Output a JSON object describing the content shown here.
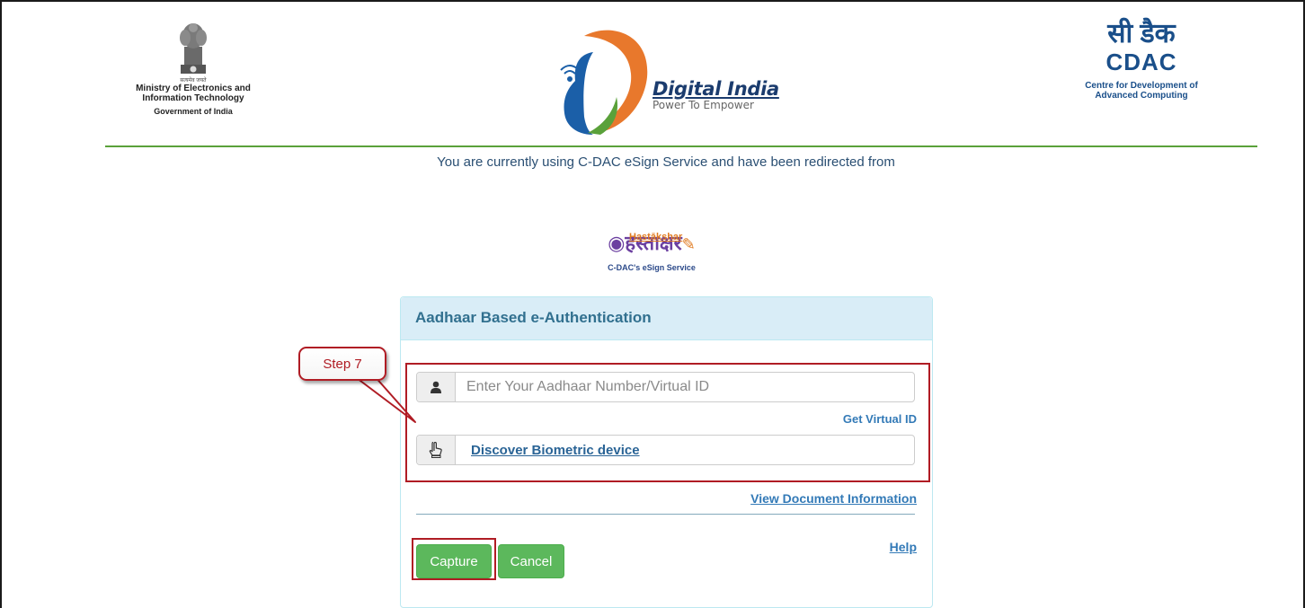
{
  "header": {
    "meity": {
      "motto": "सत्यमेव जयते",
      "line1": "Ministry of Electronics and",
      "line2": "Information Technology",
      "line3": "Government of India"
    },
    "digital_india": {
      "title": "Digital India",
      "subtitle": "Power To Empower"
    },
    "cdac": {
      "hindi": "सी डैक",
      "english": "CDAC",
      "full_line1": "Centre for Development of",
      "full_line2": "Advanced Computing"
    }
  },
  "redirect_notice": "You are currently using C-DAC eSign Service and have been redirected from",
  "esign_logo": {
    "tag": "Hastākshar",
    "brand": "हस्ताक्षर",
    "caption": "C-DAC's eSign Service"
  },
  "panel": {
    "title": "Aadhaar Based e-Authentication",
    "aadhaar_input": {
      "placeholder": "Enter Your Aadhaar Number/Virtual ID",
      "value": ""
    },
    "get_virtual_id": "Get Virtual ID",
    "discover_biometric": "Discover Biometric device",
    "view_document_info": "View Document Information",
    "help": "Help",
    "capture_button": "Capture",
    "cancel_button": "Cancel"
  },
  "annotation": {
    "step_label": "Step 7",
    "color": "#b01c24"
  },
  "colors": {
    "panel_header_bg": "#d9edf7",
    "panel_header_text": "#31708f",
    "button_green": "#5cb85c",
    "link_blue": "#337ab7",
    "rule_green": "#5aa13a"
  },
  "icons": {
    "user": "user-icon",
    "fingerprint": "pointing-hand-icon"
  }
}
